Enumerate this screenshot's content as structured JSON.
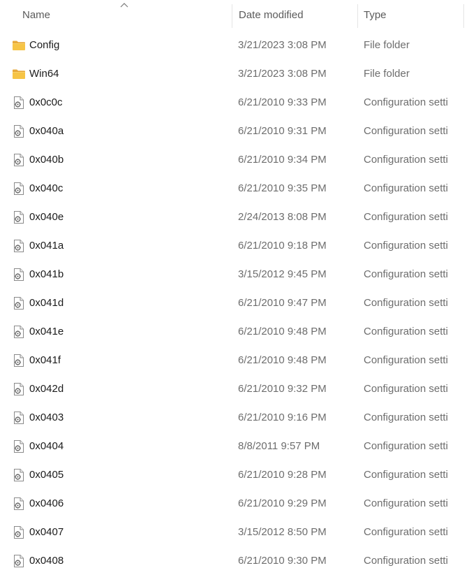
{
  "header": {
    "columns": {
      "name": "Name",
      "date": "Date modified",
      "type": "Type"
    },
    "sort": "ascending",
    "sort_icon": "chevron-up-icon"
  },
  "colors": {
    "folder": "#f6c445",
    "folder_dark": "#e7a93a",
    "text_primary": "#1b1b1b",
    "text_secondary": "#6d6d6d"
  },
  "items": [
    {
      "name": "Config",
      "date": "3/21/2023 3:08 PM",
      "type": "File folder",
      "icon": "folder-icon"
    },
    {
      "name": "Win64",
      "date": "3/21/2023 3:08 PM",
      "type": "File folder",
      "icon": "folder-icon"
    },
    {
      "name": "0x0c0c",
      "date": "6/21/2010 9:33 PM",
      "type": "Configuration setti",
      "icon": "config-file-icon"
    },
    {
      "name": "0x040a",
      "date": "6/21/2010 9:31 PM",
      "type": "Configuration setti",
      "icon": "config-file-icon"
    },
    {
      "name": "0x040b",
      "date": "6/21/2010 9:34 PM",
      "type": "Configuration setti",
      "icon": "config-file-icon"
    },
    {
      "name": "0x040c",
      "date": "6/21/2010 9:35 PM",
      "type": "Configuration setti",
      "icon": "config-file-icon"
    },
    {
      "name": "0x040e",
      "date": "2/24/2013 8:08 PM",
      "type": "Configuration setti",
      "icon": "config-file-icon"
    },
    {
      "name": "0x041a",
      "date": "6/21/2010 9:18 PM",
      "type": "Configuration setti",
      "icon": "config-file-icon"
    },
    {
      "name": "0x041b",
      "date": "3/15/2012 9:45 PM",
      "type": "Configuration setti",
      "icon": "config-file-icon"
    },
    {
      "name": "0x041d",
      "date": "6/21/2010 9:47 PM",
      "type": "Configuration setti",
      "icon": "config-file-icon"
    },
    {
      "name": "0x041e",
      "date": "6/21/2010 9:48 PM",
      "type": "Configuration setti",
      "icon": "config-file-icon"
    },
    {
      "name": "0x041f",
      "date": "6/21/2010 9:48 PM",
      "type": "Configuration setti",
      "icon": "config-file-icon"
    },
    {
      "name": "0x042d",
      "date": "6/21/2010 9:32 PM",
      "type": "Configuration setti",
      "icon": "config-file-icon"
    },
    {
      "name": "0x0403",
      "date": "6/21/2010 9:16 PM",
      "type": "Configuration setti",
      "icon": "config-file-icon"
    },
    {
      "name": "0x0404",
      "date": "8/8/2011 9:57 PM",
      "type": "Configuration setti",
      "icon": "config-file-icon"
    },
    {
      "name": "0x0405",
      "date": "6/21/2010 9:28 PM",
      "type": "Configuration setti",
      "icon": "config-file-icon"
    },
    {
      "name": "0x0406",
      "date": "6/21/2010 9:29 PM",
      "type": "Configuration setti",
      "icon": "config-file-icon"
    },
    {
      "name": "0x0407",
      "date": "3/15/2012 8:50 PM",
      "type": "Configuration setti",
      "icon": "config-file-icon"
    },
    {
      "name": "0x0408",
      "date": "6/21/2010 9:30 PM",
      "type": "Configuration setti",
      "icon": "config-file-icon"
    }
  ]
}
